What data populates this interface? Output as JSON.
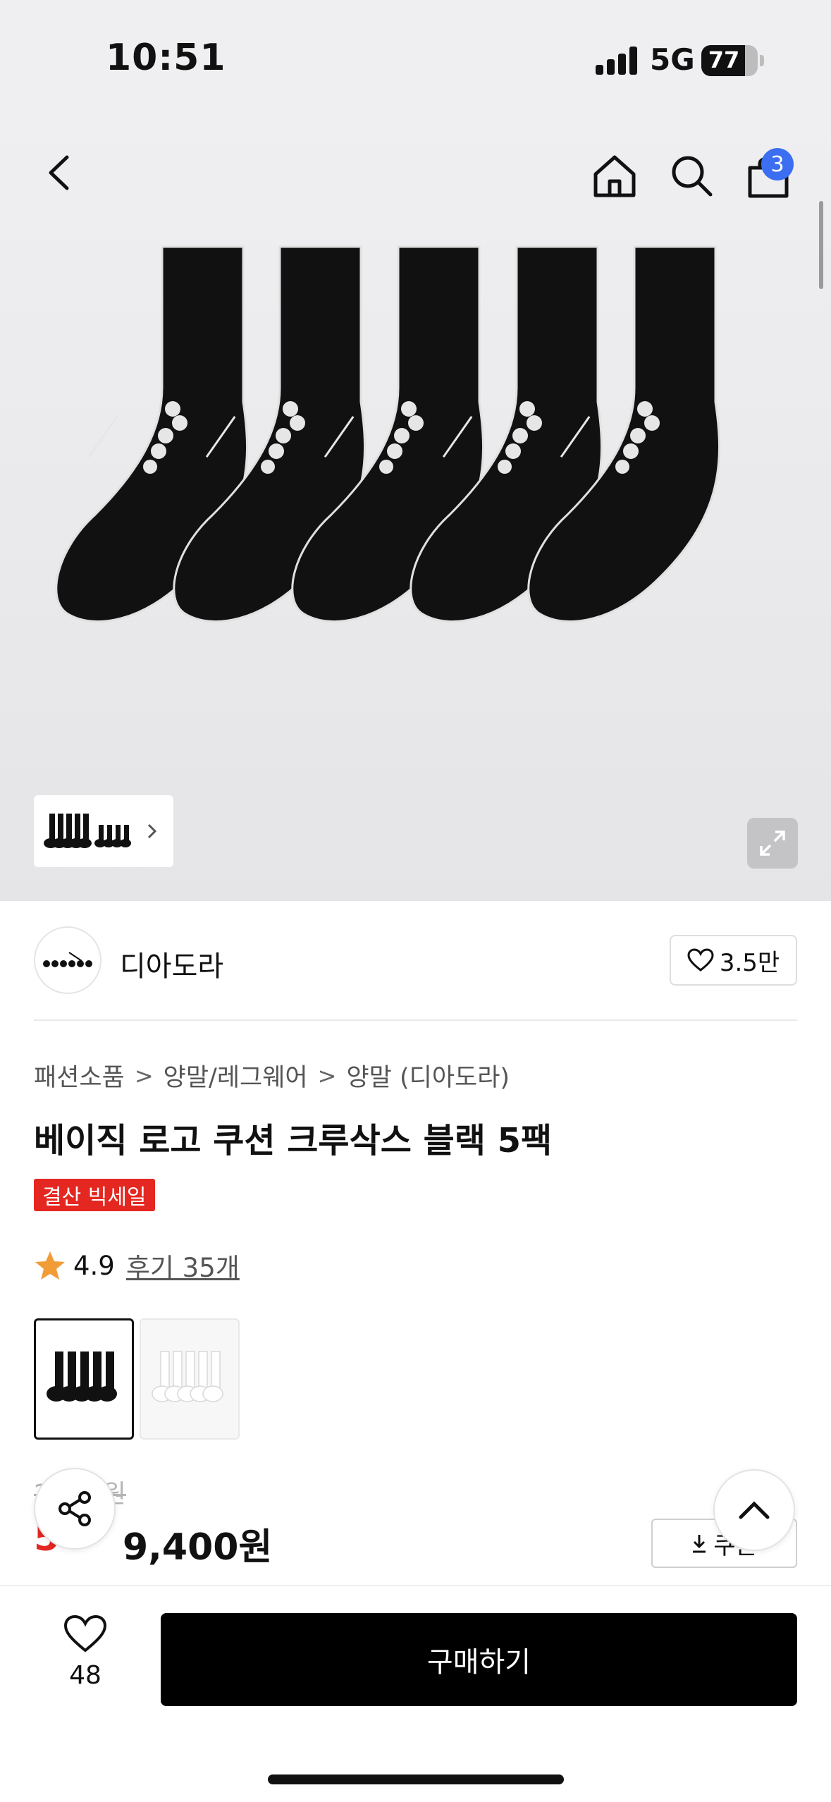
{
  "status_bar": {
    "time": "10:51",
    "network": "5G",
    "battery": "77",
    "battery_level": 0.77
  },
  "nav": {
    "cart_count": "3"
  },
  "brand": {
    "name": "디아도라",
    "likes": "3.5만"
  },
  "breadcrumb": [
    "패션소품",
    "양말/레그웨어",
    "양말 (디아도라)"
  ],
  "product": {
    "title": "베이직 로고 쿠션 크루삭스 블랙 5팩",
    "sale_tag": "결산 빅세일",
    "rating": "4.9",
    "review_link": "후기 35개",
    "original_price": "2",
    "original_price_suffix": "0원",
    "discount": "5",
    "price": "9,400원",
    "coupon_label": "쿠폰",
    "colors": [
      "black",
      "white"
    ]
  },
  "bottom_bar": {
    "wish_count": "48",
    "buy_label": "구매하기"
  },
  "theme": {
    "accent": "#e42720",
    "badge": "#3b6ef0",
    "star": "#f29c38"
  }
}
